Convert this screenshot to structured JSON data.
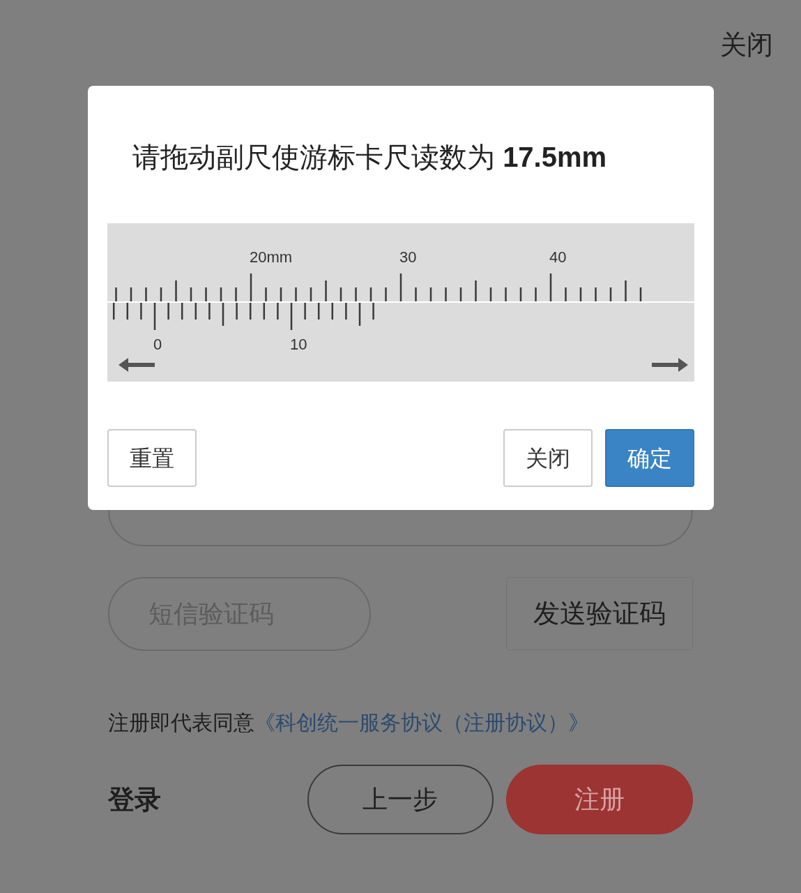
{
  "page": {
    "close_label": "关闭",
    "sms_field": {
      "placeholder": "短信验证码"
    },
    "send_code_button": "发送验证码",
    "agreement": {
      "text": "注册即代表同意",
      "link": "《科创统一服务协议（注册协议）》"
    },
    "login_link": "登录",
    "back_button": "上一步",
    "register_button": "注册"
  },
  "dialog": {
    "title": "请拖动副尺使游标卡尺读数为 **17.5mm**",
    "ruler": {
      "main_labels": [
        "20mm",
        "30",
        "40"
      ],
      "vernier_labels": [
        "0",
        "10"
      ]
    },
    "buttons": [
      {
        "label": "重置",
        "kind": "default"
      },
      {
        "label": "关闭",
        "kind": "default"
      },
      {
        "label": "确定",
        "kind": "primary"
      }
    ]
  }
}
